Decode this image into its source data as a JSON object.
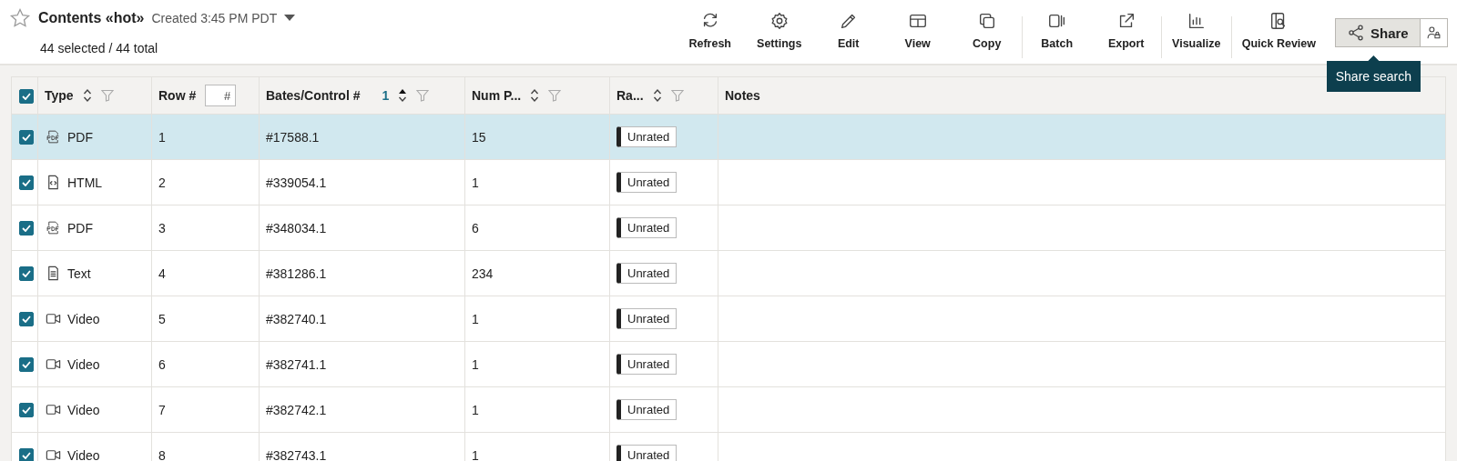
{
  "header": {
    "title": "Contents «hot»",
    "created": "Created 3:45 PM PDT",
    "selection_count": "44 selected / 44 total"
  },
  "toolbar": {
    "groups": [
      [
        {
          "label": "Refresh"
        },
        {
          "label": "Settings"
        },
        {
          "label": "Edit"
        },
        {
          "label": "View"
        },
        {
          "label": "Copy"
        }
      ],
      [
        {
          "label": "Batch"
        },
        {
          "label": "Export"
        }
      ],
      [
        {
          "label": "Visualize"
        }
      ],
      [
        {
          "label": "Quick Review"
        }
      ]
    ],
    "share_button": {
      "label": "Share"
    },
    "tooltip": "Share search"
  },
  "table": {
    "all_checked": true,
    "columns": [
      {
        "label": "Type",
        "sorted": false,
        "filter": true
      },
      {
        "label": "Row #",
        "kind": "input",
        "placeholder": "#"
      },
      {
        "label": "Bates/Control #",
        "sorted": true,
        "sort_order": "1",
        "filter": true
      },
      {
        "label": "Num P...",
        "sorted": false,
        "filter": true
      },
      {
        "label": "Ra...",
        "sorted": false,
        "filter": true
      },
      {
        "label": "Notes"
      }
    ],
    "rows": [
      {
        "checked": true,
        "selected": true,
        "type": "PDF",
        "kind": "pdf",
        "row": "1",
        "bates": "#17588.1",
        "pages": "15",
        "rating": "Unrated"
      },
      {
        "checked": true,
        "selected": false,
        "type": "HTML",
        "kind": "html",
        "row": "2",
        "bates": "#339054.1",
        "pages": "1",
        "rating": "Unrated"
      },
      {
        "checked": true,
        "selected": false,
        "type": "PDF",
        "kind": "pdf",
        "row": "3",
        "bates": "#348034.1",
        "pages": "6",
        "rating": "Unrated"
      },
      {
        "checked": true,
        "selected": false,
        "type": "Text",
        "kind": "text",
        "row": "4",
        "bates": "#381286.1",
        "pages": "234",
        "rating": "Unrated"
      },
      {
        "checked": true,
        "selected": false,
        "type": "Video",
        "kind": "video",
        "row": "5",
        "bates": "#382740.1",
        "pages": "1",
        "rating": "Unrated"
      },
      {
        "checked": true,
        "selected": false,
        "type": "Video",
        "kind": "video",
        "row": "6",
        "bates": "#382741.1",
        "pages": "1",
        "rating": "Unrated"
      },
      {
        "checked": true,
        "selected": false,
        "type": "Video",
        "kind": "video",
        "row": "7",
        "bates": "#382742.1",
        "pages": "1",
        "rating": "Unrated"
      },
      {
        "checked": true,
        "selected": false,
        "type": "Video",
        "kind": "video",
        "row": "8",
        "bates": "#382743.1",
        "pages": "1",
        "rating": "Unrated"
      }
    ]
  }
}
